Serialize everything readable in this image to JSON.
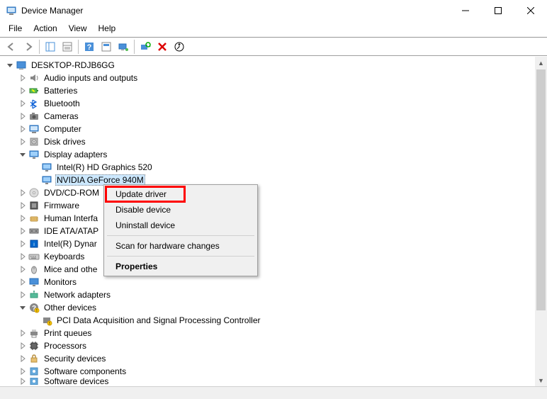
{
  "window": {
    "title": "Device Manager"
  },
  "menu": {
    "file": "File",
    "action": "Action",
    "view": "View",
    "help": "Help"
  },
  "tree": {
    "root": "DESKTOP-RDJB6GG",
    "nodes": [
      {
        "label": "Audio inputs and outputs",
        "icon": "audio",
        "exp": "closed"
      },
      {
        "label": "Batteries",
        "icon": "battery",
        "exp": "closed"
      },
      {
        "label": "Bluetooth",
        "icon": "bluetooth",
        "exp": "closed"
      },
      {
        "label": "Cameras",
        "icon": "camera",
        "exp": "closed"
      },
      {
        "label": "Computer",
        "icon": "computer",
        "exp": "closed"
      },
      {
        "label": "Disk drives",
        "icon": "disk",
        "exp": "closed"
      },
      {
        "label": "Display adapters",
        "icon": "display",
        "exp": "open",
        "children": [
          {
            "label": "Intel(R) HD Graphics 520",
            "icon": "display"
          },
          {
            "label": "NVIDIA GeForce 940M",
            "icon": "display",
            "selected": true
          }
        ]
      },
      {
        "label": "DVD/CD-ROM",
        "icon": "dvd",
        "exp": "closed",
        "trunc": true
      },
      {
        "label": "Firmware",
        "icon": "firmware",
        "exp": "closed"
      },
      {
        "label": "Human Interfa",
        "icon": "hid",
        "exp": "closed",
        "trunc": true
      },
      {
        "label": "IDE ATA/ATAP",
        "icon": "ide",
        "exp": "closed",
        "trunc": true
      },
      {
        "label": "Intel(R) Dynar",
        "icon": "intel",
        "exp": "closed",
        "trunc": true
      },
      {
        "label": "Keyboards",
        "icon": "keyboard",
        "exp": "closed"
      },
      {
        "label": "Mice and othe",
        "icon": "mouse",
        "exp": "closed",
        "trunc": true
      },
      {
        "label": "Monitors",
        "icon": "monitor",
        "exp": "closed"
      },
      {
        "label": "Network adapters",
        "icon": "network",
        "exp": "closed"
      },
      {
        "label": "Other devices",
        "icon": "other",
        "exp": "open",
        "children": [
          {
            "label": "PCI Data Acquisition and Signal Processing Controller",
            "icon": "other-warn"
          }
        ]
      },
      {
        "label": "Print queues",
        "icon": "printer",
        "exp": "closed"
      },
      {
        "label": "Processors",
        "icon": "cpu",
        "exp": "closed"
      },
      {
        "label": "Security devices",
        "icon": "security",
        "exp": "closed"
      },
      {
        "label": "Software components",
        "icon": "software",
        "exp": "closed"
      },
      {
        "label": "Software devices",
        "icon": "software",
        "exp": "closed",
        "cut": true
      }
    ]
  },
  "context_menu": {
    "update": "Update driver",
    "disable": "Disable device",
    "uninstall": "Uninstall device",
    "scan": "Scan for hardware changes",
    "properties": "Properties"
  },
  "toolbar": {
    "back": "back",
    "forward": "forward",
    "up": "up",
    "props": "properties",
    "help": "help",
    "refresh": "refresh",
    "monitor": "show hidden",
    "scan": "scan",
    "delete": "delete",
    "update": "update"
  }
}
